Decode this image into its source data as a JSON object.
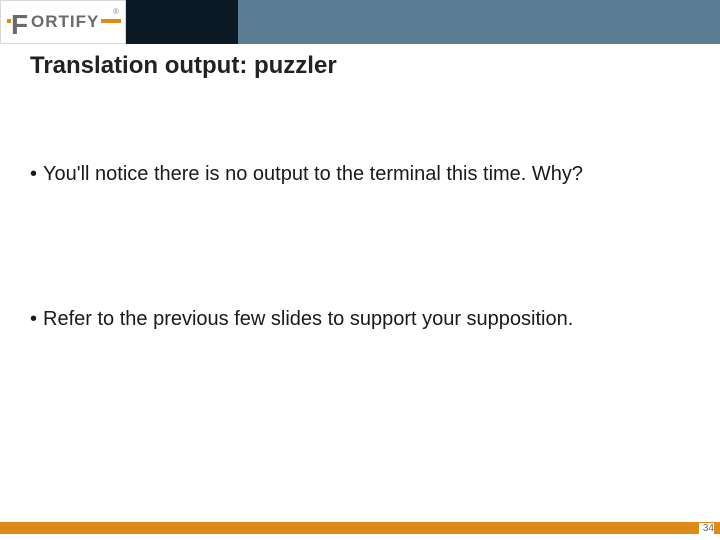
{
  "logo": {
    "first_letter": "F",
    "rest": "ORTIFY",
    "registered": "®"
  },
  "title": "Translation output: puzzler",
  "bullets": [
    "You'll notice there is no output to the terminal this time. Why?",
    "Refer to the previous few slides to support your supposition."
  ],
  "page_number": "34"
}
